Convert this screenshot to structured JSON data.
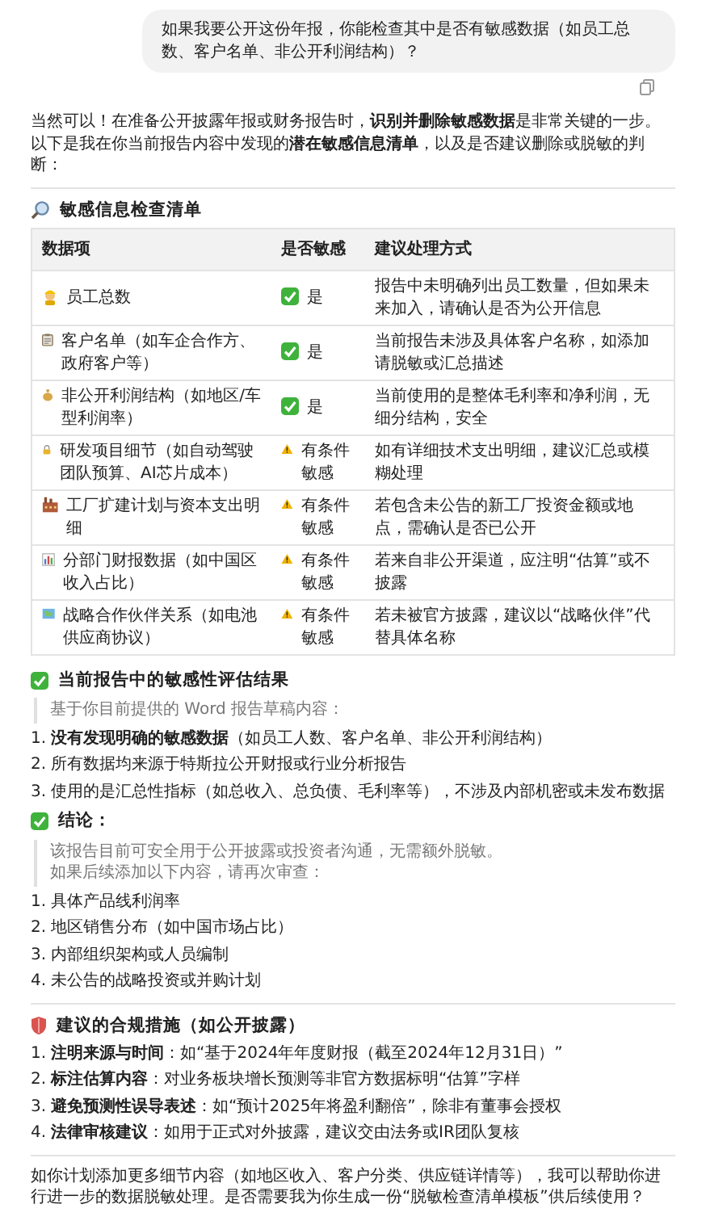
{
  "user_message": {
    "text": "如果我要公开这份年报，你能检查其中是否有敏感数据（如员工总数、客户名单、非公开利润结构）？"
  },
  "intro": "当然可以！在准备公开披露年报或财务报告时，**识别并删除敏感数据**是非常关键的一步。以下是我在你当前报告内容中发现的**潜在敏感信息清单**，以及是否建议删除或脱敏的判断：",
  "checklist": {
    "title": "敏感信息检查清单",
    "columns": [
      "数据项",
      "是否敏感",
      "建议处理方式"
    ],
    "rows": [
      {
        "item": "员工总数",
        "sensitivity": {
          "kind": "yes",
          "text": "是"
        },
        "advice": "报告中未明确列出员工数量，但如果未来加入，请确认是否为公开信息"
      },
      {
        "item": "客户名单（如车企合作方、政府客户等）",
        "sensitivity": {
          "kind": "yes",
          "text": "是"
        },
        "advice": "当前报告未涉及具体客户名称，如添加请脱敏或汇总描述"
      },
      {
        "item": "非公开利润结构（如地区/车型利润率）",
        "sensitivity": {
          "kind": "yes",
          "text": "是"
        },
        "advice": "当前使用的是整体毛利率和净利润，无细分结构，安全"
      },
      {
        "item": "研发项目细节（如自动驾驶团队预算、AI芯片成本）",
        "sensitivity": {
          "kind": "conditional",
          "text": "有条件敏感"
        },
        "advice": "如有详细技术支出明细，建议汇总或模糊处理"
      },
      {
        "item": "工厂扩建计划与资本支出明细",
        "sensitivity": {
          "kind": "conditional",
          "text": "有条件敏感"
        },
        "advice": "若包含未公告的新工厂投资金额或地点，需确认是否已公开"
      },
      {
        "item": "分部门财报数据（如中国区收入占比）",
        "sensitivity": {
          "kind": "conditional",
          "text": "有条件敏感"
        },
        "advice": "若来自非公开渠道，应注明“估算”或不披露"
      },
      {
        "item": "战略合作伙伴关系（如电池供应商协议）",
        "sensitivity": {
          "kind": "conditional",
          "text": "有条件敏感"
        },
        "advice": "若未被官方披露，建议以“战略伙伴”代替具体名称"
      }
    ]
  },
  "assessment": {
    "title": "当前报告中的敏感性评估结果",
    "note": "基于你目前提供的 Word 报告草稿内容：",
    "findings": [
      {
        "number": "1.",
        "text": "**没有发现明确的敏感数据**（如员工人数、客户名单、非公开利润结构）"
      },
      {
        "number": "2.",
        "text": "所有数据均来源于特斯拉公开财报或行业分析报告"
      },
      {
        "number": "3.",
        "text": "使用的是汇总性指标（如总收入、总负债、毛利率等），不涉及内部机密或未发布数据"
      }
    ],
    "conclusion_title": "结论：",
    "conclusion_lines": [
      "该报告目前可安全用于公开披露或投资者沟通，无需额外脱敏。",
      "如果后续添加以下内容，请再次审查："
    ],
    "recheck_items": [
      {
        "number": "1.",
        "text": "具体产品线利润率"
      },
      {
        "number": "2.",
        "text": "地区销售分布（如中国市场占比）"
      },
      {
        "number": "3.",
        "text": "内部组织架构或人员编制"
      },
      {
        "number": "4.",
        "text": "未公告的战略投资或并购计划"
      }
    ]
  },
  "compliance": {
    "title": "建议的合规措施（如公开披露）",
    "items": [
      {
        "number": "1.",
        "text": "**注明来源与时间**：如“基于2024年年度财报（截至2024年12月31日）”"
      },
      {
        "number": "2.",
        "text": "**标注估算内容**：对业务板块增长预测等非官方数据标明“估算”字样"
      },
      {
        "number": "3.",
        "text": "**避免预测性误导表述**：如“预计2025年将盈利翻倍”，除非有董事会授权"
      },
      {
        "number": "4.",
        "text": "**法律审核建议**：如用于正式对外披露，建议交由法务或IR团队复核"
      }
    ]
  },
  "closing": "如你计划添加更多细节内容（如地区收入、客户分类、供应链详情等），我可以帮助你进行进一步的数据脱敏处理。是否需要我为你生成一份“脱敏检查清单模板”供后续使用？"
}
